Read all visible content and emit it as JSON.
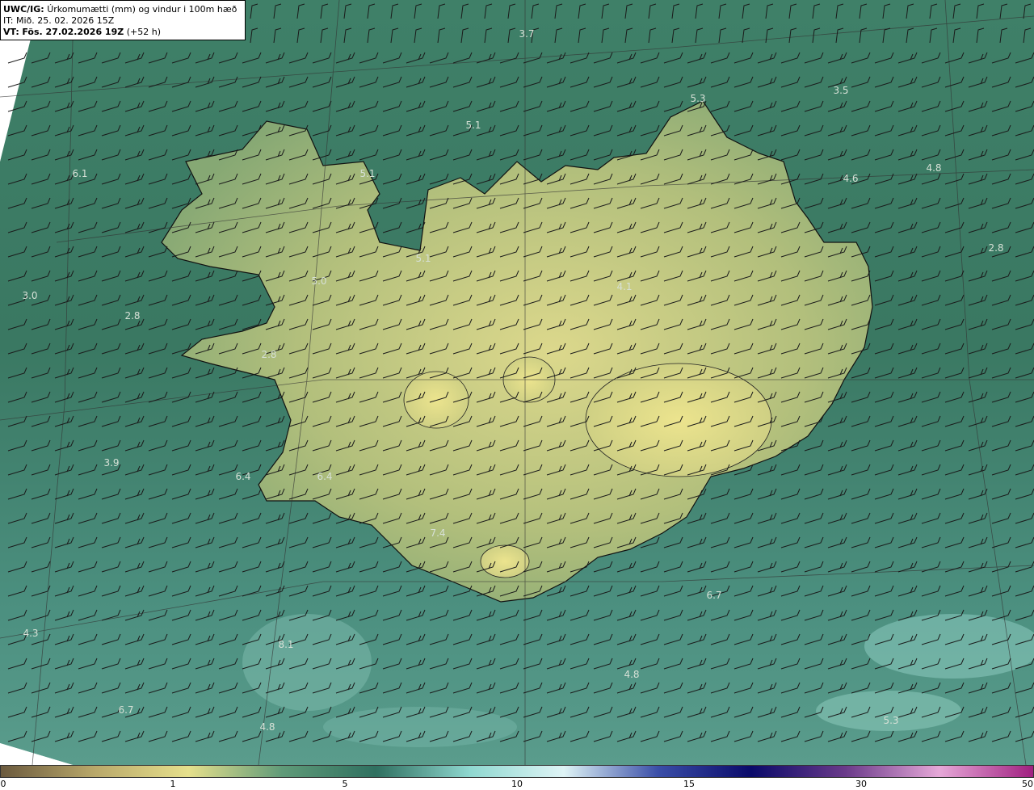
{
  "header": {
    "model": "UWC/IG:",
    "description": "Úrkomumætti (mm) og vindur i 100m hæð",
    "init_time": "IT: Mið. 25. 02. 2026 15Z",
    "valid_prefix": "VT:",
    "valid_time": "Fös. 27.02.2026 19Z",
    "lead": "(+52 h)"
  },
  "colors": {
    "sea_dark": "#2e6e5a",
    "sea_mid": "#4a8a6e",
    "land_yellow": "#d8d68a",
    "land_mid": "#a8b87a",
    "coastline": "#111111",
    "barb": "#1a1a1a"
  },
  "value_labels": [
    {
      "text": "3.7"
    },
    {
      "text": "5.3"
    },
    {
      "text": "3.5"
    },
    {
      "text": "5.1"
    },
    {
      "text": "6.1"
    },
    {
      "text": "5.1"
    },
    {
      "text": "4.6"
    },
    {
      "text": "4.8"
    },
    {
      "text": "2.8"
    },
    {
      "text": "5.1"
    },
    {
      "text": "5.0"
    },
    {
      "text": "4.1"
    },
    {
      "text": "3.0"
    },
    {
      "text": "2.8"
    },
    {
      "text": "2.8"
    },
    {
      "text": "3.9"
    },
    {
      "text": "6.4"
    },
    {
      "text": "6.4"
    },
    {
      "text": "7.4"
    },
    {
      "text": "6.7"
    },
    {
      "text": "4.3"
    },
    {
      "text": "8.1"
    },
    {
      "text": "4.8"
    },
    {
      "text": "6.7"
    },
    {
      "text": "4.8"
    },
    {
      "text": "5.3"
    }
  ],
  "colorbar": {
    "ticks": [
      "0",
      "1",
      "5",
      "10",
      "15",
      "30",
      "50"
    ],
    "colors": [
      "#6b5a3e",
      "#b9a86a",
      "#e6e08c",
      "#5f9a78",
      "#2f7060",
      "#8fd8d0",
      "#dff4f6",
      "#3a4ea8",
      "#0a0a6a",
      "#6a3a8a",
      "#e6a8d8",
      "#a02080"
    ]
  }
}
